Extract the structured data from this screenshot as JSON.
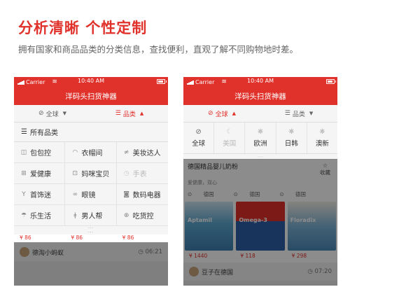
{
  "headline": "分析清晰  个性定制",
  "subline": "拥有国家和商品品类的分类信息，查找便利，直观了解不同购物地时差。",
  "status": {
    "carrier": "Carrier",
    "time": "10:40 AM"
  },
  "app_title": "洋码头扫货神器",
  "colors": {
    "accent": "#e0312b"
  },
  "phone1": {
    "tabs": [
      {
        "icon": "globe-icon",
        "label": "全球",
        "active": false
      },
      {
        "icon": "list-icon",
        "label": "品类",
        "active": true
      }
    ],
    "all_label": "所有品类",
    "categories": [
      {
        "icon": "bag-icon",
        "label": "包包控"
      },
      {
        "icon": "hat-icon",
        "label": "衣帽间"
      },
      {
        "icon": "lipstick-icon",
        "label": "美妆达人"
      },
      {
        "icon": "health-icon",
        "label": "爱健康"
      },
      {
        "icon": "baby-icon",
        "label": "妈咪宝贝"
      },
      {
        "icon": "watch-icon",
        "label": "手表",
        "disabled": true
      },
      {
        "icon": "necklace-icon",
        "label": "首饰迷"
      },
      {
        "icon": "glasses-icon",
        "label": "眼镜"
      },
      {
        "icon": "camera-icon",
        "label": "数码电器"
      },
      {
        "icon": "umbrella-icon",
        "label": "乐生活"
      },
      {
        "icon": "tie-icon",
        "label": "男人帮"
      },
      {
        "icon": "food-icon",
        "label": "吃货控"
      }
    ],
    "prices": [
      "¥ 86",
      "¥ 86",
      "¥ 86"
    ],
    "user": {
      "name": "德淘小蚂蚁",
      "time": "06:21"
    }
  },
  "phone2": {
    "tabs": [
      {
        "icon": "globe-icon",
        "label": "全球",
        "active": true
      },
      {
        "icon": "list-icon",
        "label": "品类",
        "active": false
      }
    ],
    "regions": [
      {
        "icon": "globe-icon",
        "label": "全球"
      },
      {
        "icon": "moon-icon",
        "label": "美国",
        "disabled": true
      },
      {
        "icon": "sun-icon",
        "label": "欧洲"
      },
      {
        "icon": "sun-icon",
        "label": "日韩"
      },
      {
        "icon": "sun-icon",
        "label": "澳新"
      }
    ],
    "feed_title": "德国精品婴儿奶粉",
    "fav_label": "收藏",
    "tags": "爱健康，双心",
    "locations": [
      "德国",
      "德国",
      "德国"
    ],
    "products": [
      "Aptamil",
      "Omega-3",
      "Floradix"
    ],
    "prices": [
      "¥ 1440",
      "¥ 118",
      "¥ 298"
    ],
    "user": {
      "name": "豆子在德国",
      "time": "07:20"
    }
  }
}
